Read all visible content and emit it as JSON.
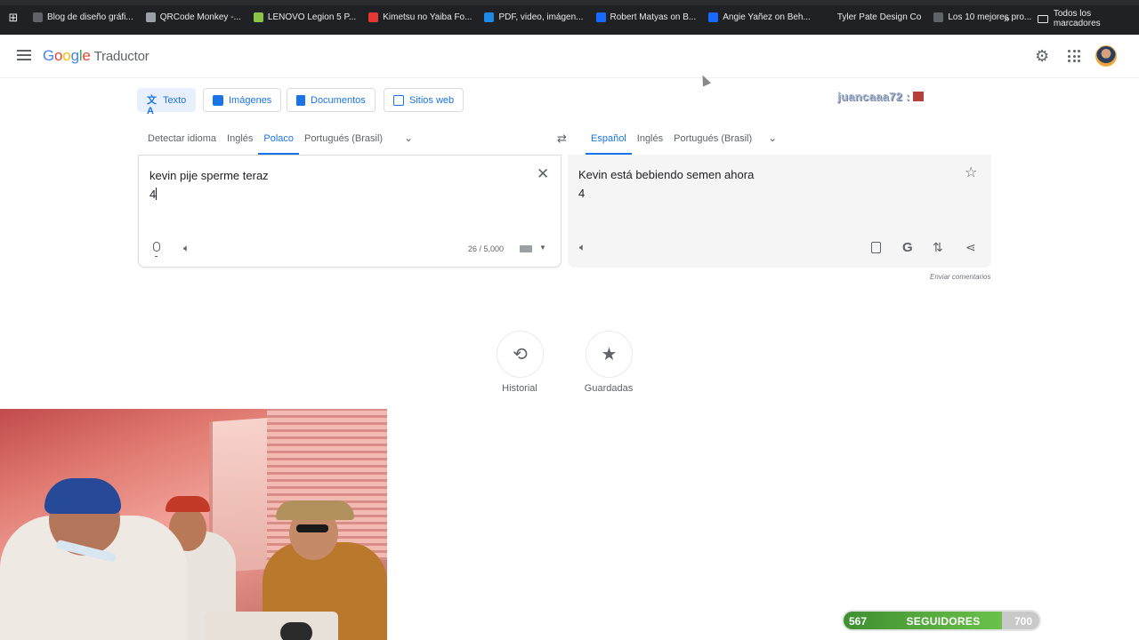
{
  "bookmarks": [
    {
      "label": "Blog de diseño gráfi...",
      "icon": "google-icon",
      "color": "#5f6368"
    },
    {
      "label": "QRCode Monkey -...",
      "icon": "qrcode-monkey-icon",
      "color": "#9aa0a6"
    },
    {
      "label": "LENOVO Legion 5 P...",
      "icon": "lenovo-icon",
      "color": "#8bc34a"
    },
    {
      "label": "Kimetsu no Yaiba Fo...",
      "icon": "kimetsu-icon",
      "color": "#e53935"
    },
    {
      "label": "PDF, video, imágen...",
      "icon": "pdf-tool-icon",
      "color": "#1e88e5"
    },
    {
      "label": "Robert Matyas on B...",
      "icon": "behance-icon",
      "color": "#1769ff"
    },
    {
      "label": "Angie Yañez on Beh...",
      "icon": "behance-icon",
      "color": "#1769ff"
    },
    {
      "label": "Tyler Pate Design Co",
      "icon": "blank-icon",
      "color": "#202124"
    },
    {
      "label": "Los 10 mejores pro...",
      "icon": "bookmark-icon",
      "color": "#5f6368"
    }
  ],
  "all_bookmarks": "Todos los marcadores",
  "header": {
    "logo": {
      "g": "G",
      "o1": "o",
      "o2": "o",
      "g2": "g",
      "l": "l",
      "e": "e"
    },
    "product": "Traductor"
  },
  "modes": [
    {
      "label": "Texto",
      "active": true
    },
    {
      "label": "Imágenes",
      "active": false
    },
    {
      "label": "Documentos",
      "active": false
    },
    {
      "label": "Sitios web",
      "active": false
    }
  ],
  "watermark": "juancaaa72 :",
  "source_langs": {
    "detect": "Detectar idioma",
    "items": [
      "Inglés",
      "Polaco",
      "Portugués (Brasil)"
    ],
    "active": "Polaco"
  },
  "target_langs": {
    "items": [
      "Español",
      "Inglés",
      "Portugués (Brasil)"
    ],
    "active": "Español"
  },
  "source": {
    "line1": "kevin pije sperme teraz",
    "line2": "4",
    "counter": "26 / 5,000"
  },
  "target": {
    "line1": "Kevin está bebiendo semen ahora",
    "line2": "4"
  },
  "feedback": "Enviar comentarios",
  "history_label": "Historial",
  "saved_label": "Guardadas",
  "followers": {
    "current": "567",
    "label": "SEGUIDORES",
    "goal": "700",
    "progress": 0.81
  }
}
